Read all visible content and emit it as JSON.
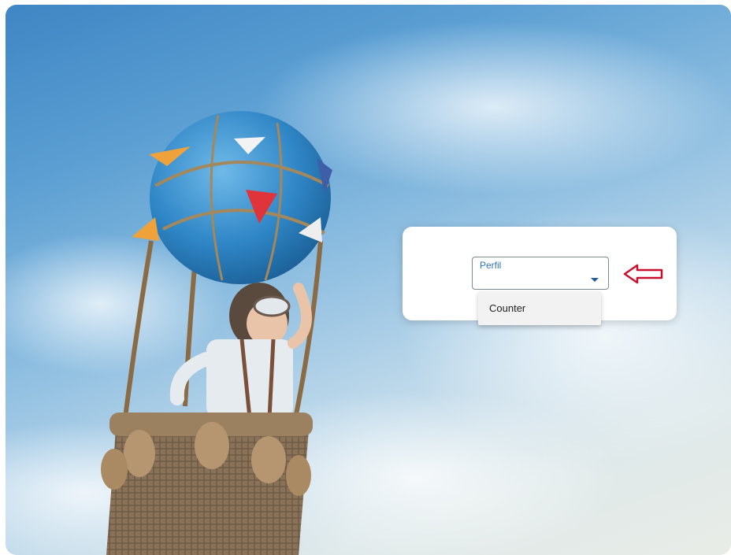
{
  "form": {
    "select_label": "Perfil",
    "select_value": "",
    "options": [
      "Counter"
    ]
  },
  "background": {
    "description_icon": "hot-air-balloon-photo"
  },
  "colors": {
    "label": "#2e74b5",
    "arrow": "#c8102e",
    "caret": "#1f5f99"
  }
}
